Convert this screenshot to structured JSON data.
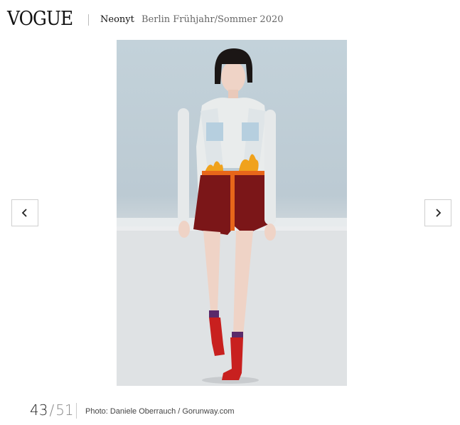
{
  "header": {
    "logo": "VOGUE",
    "brand": "Neonyt",
    "event": "Berlin Frühjahr/Sommer 2020"
  },
  "gallery": {
    "prev_icon": "chevron-left-icon",
    "next_icon": "chevron-right-icon",
    "current": "43",
    "separator": "/",
    "total": "51",
    "credit": "Photo: Daniele Oberrauch / Gorunway.com"
  },
  "colors": {
    "background": "#ffffff",
    "text": "#222222",
    "muted": "#888888",
    "border": "#cfcfcf"
  }
}
